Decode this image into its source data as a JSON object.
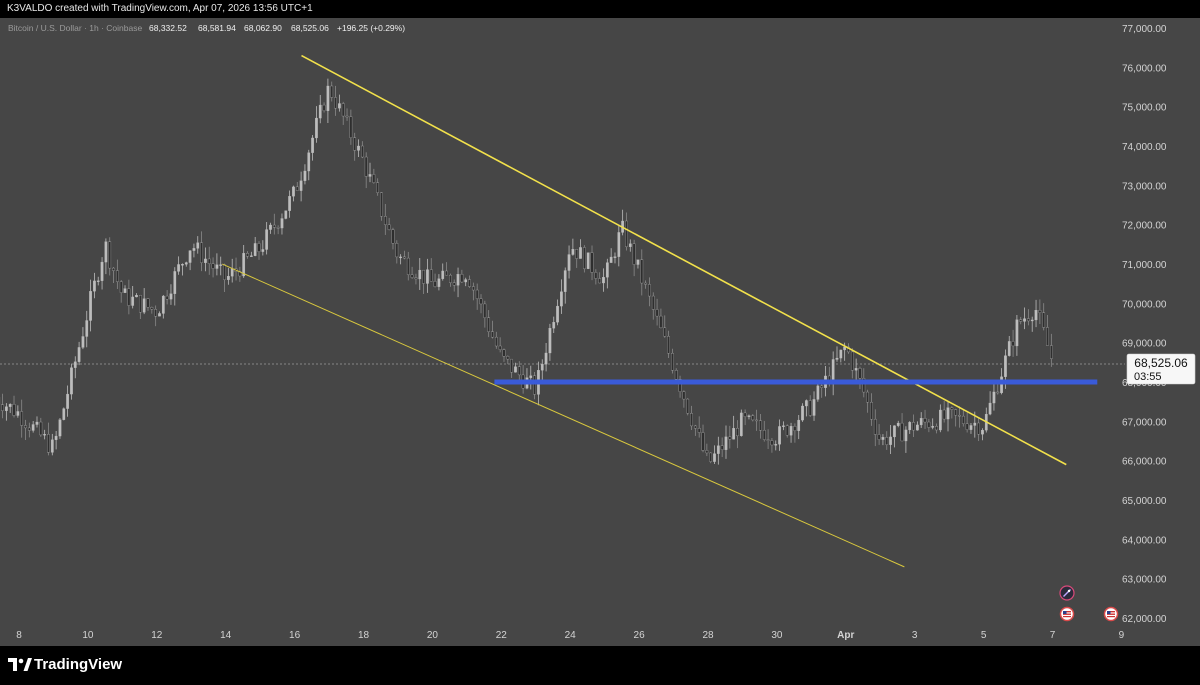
{
  "attribution": "K3VALDO created with TradingView.com, Apr 07, 2026 13:56 UTC+1",
  "legend": {
    "symbol": "Bitcoin / U.S. Dollar · 1h · Coinbase",
    "open": "68,332.52",
    "high": "68,581.94",
    "low": "68,062.90",
    "close": "68,525.06",
    "change": "+196.25 (+0.29%)"
  },
  "price_tag": {
    "price": "68,525.06",
    "countdown": "03:55"
  },
  "brand": "TradingView",
  "colors": {
    "background": "#464646",
    "candles": "#bdbdbd",
    "trendline": "#f2e14b",
    "support": "#3a5bd9"
  },
  "chart_data": {
    "type": "candlestick",
    "series": [
      {
        "name": "BTC/USD 1h"
      }
    ],
    "x_tick_labels": [
      "8",
      "10",
      "12",
      "14",
      "16",
      "18",
      "20",
      "22",
      "24",
      "26",
      "28",
      "30",
      "Apr",
      "3",
      "5",
      "7",
      "9"
    ],
    "y_tick_labels": [
      "62,000.00",
      "63,000.00",
      "64,000.00",
      "65,000.00",
      "66,000.00",
      "67,000.00",
      "68,000.00",
      "69,000.00",
      "70,000.00",
      "71,000.00",
      "72,000.00",
      "73,000.00",
      "74,000.00",
      "75,000.00",
      "76,000.00",
      "77,000.00"
    ],
    "ylim": [
      62000,
      77000
    ],
    "approx_path": [
      [
        "Mar 7",
        67800
      ],
      [
        "Mar 8",
        67200
      ],
      [
        "Mar 9",
        66300
      ],
      [
        "Mar 10",
        69800
      ],
      [
        "Mar 10.5",
        71500
      ],
      [
        "Mar 11",
        70200
      ],
      [
        "Mar 12",
        69800
      ],
      [
        "Mar 13",
        71500
      ],
      [
        "Mar 14",
        70600
      ],
      [
        "Mar 15",
        71400
      ],
      [
        "Mar 16",
        72800
      ],
      [
        "Mar 17",
        75500
      ],
      [
        "Mar 18",
        73600
      ],
      [
        "Mar 19",
        71200
      ],
      [
        "Mar 20",
        70500
      ],
      [
        "Mar 21",
        70800
      ],
      [
        "Mar 22",
        68600
      ],
      [
        "Mar 23",
        67800
      ],
      [
        "Mar 24",
        71500
      ],
      [
        "Mar 25",
        70600
      ],
      [
        "Mar 25.5",
        71900
      ],
      [
        "Mar 26",
        70800
      ],
      [
        "Mar 27",
        68400
      ],
      [
        "Mar 28",
        65900
      ],
      [
        "Mar 29",
        67000
      ],
      [
        "Mar 30",
        66600
      ],
      [
        "Mar 31",
        67400
      ],
      [
        "Apr 1",
        68900
      ],
      [
        "Apr 1.5",
        67800
      ],
      [
        "Apr 2",
        66500
      ],
      [
        "Apr 3",
        66900
      ],
      [
        "Apr 4",
        67100
      ],
      [
        "Apr 5",
        66900
      ],
      [
        "Apr 5.5",
        68200
      ],
      [
        "Apr 6",
        69500
      ],
      [
        "Apr 6.5",
        69900
      ],
      [
        "Apr 7",
        68525
      ]
    ],
    "last_price": 68525.06,
    "annotations": [
      {
        "kind": "trendline",
        "from": [
          "Mar 16.2",
          76300
        ],
        "to": [
          "Apr 7.4",
          65900
        ]
      },
      {
        "kind": "trendline",
        "from": [
          "Mar 13.9",
          71000
        ],
        "to": [
          "Apr 2.7",
          63300
        ]
      },
      {
        "kind": "horizontal",
        "price": 68000,
        "from": "Mar 21.8",
        "to": "Apr 8.3"
      }
    ]
  }
}
